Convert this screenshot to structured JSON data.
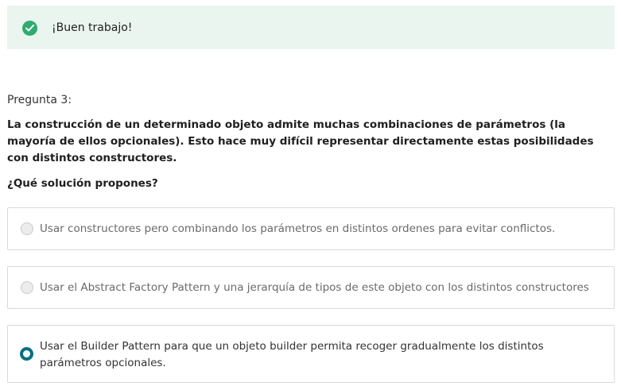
{
  "banner": {
    "message": "¡Buen trabajo!",
    "icon": "check-circle-icon",
    "icon_color": "#2faa70",
    "background": "#eaf5ef"
  },
  "question": {
    "number_label": "Pregunta 3:",
    "text": "La construcción de un determinado objeto admite muchas combinaciones de parámetros (la mayoría de ellos opcionales). Esto hace muy difícil representar directamente estas posibilidades con distintos constructores.",
    "prompt": "¿Qué solución propones?"
  },
  "options": [
    {
      "label": "Usar constructores pero combinando los parámetros en distintos ordenes para evitar conflictos.",
      "selected": false
    },
    {
      "label": "Usar el Abstract Factory Pattern y una jerarquía de tipos de este objeto con los distintos constructores",
      "selected": false
    },
    {
      "label": "Usar el Builder Pattern para que un objeto builder permita recoger gradualmente los distintos parámetros opcionales.",
      "selected": true
    }
  ],
  "colors": {
    "selected_radio": "#0b6f83"
  }
}
